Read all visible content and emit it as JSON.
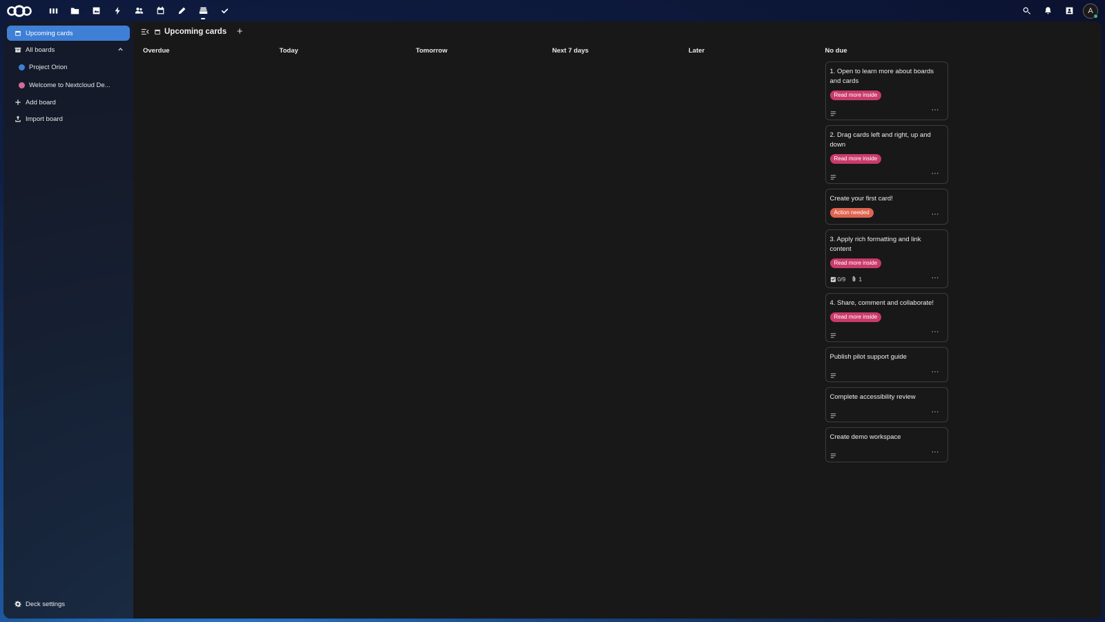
{
  "topbar": {
    "apps": [
      {
        "icon": "dashboard-icon"
      },
      {
        "icon": "files-icon"
      },
      {
        "icon": "photos-icon"
      },
      {
        "icon": "activity-icon"
      },
      {
        "icon": "contacts-icon"
      },
      {
        "icon": "calendar-icon"
      },
      {
        "icon": "notes-icon"
      },
      {
        "icon": "deck-icon",
        "active": true
      },
      {
        "icon": "tasks-icon"
      }
    ],
    "avatar_initial": "A"
  },
  "sidebar": {
    "items": [
      {
        "label": "Upcoming cards"
      },
      {
        "label": "All boards"
      },
      {
        "label": "Project Orion",
        "color": "#3f7fd6"
      },
      {
        "label": "Welcome to Nextcloud De...",
        "color": "#d36a9b"
      },
      {
        "label": "Add board"
      },
      {
        "label": "Import board"
      }
    ],
    "settings_label": "Deck settings"
  },
  "main": {
    "title": "Upcoming cards"
  },
  "columns": [
    {
      "title": "Overdue"
    },
    {
      "title": "Today"
    },
    {
      "title": "Tomorrow"
    },
    {
      "title": "Next 7 days"
    },
    {
      "title": "Later"
    },
    {
      "title": "No due"
    }
  ],
  "cards": [
    {
      "title": "1. Open to learn more about boards and cards",
      "label": "Read more inside",
      "label_color": "#c93b6a"
    },
    {
      "title": "2. Drag cards left and right, up and down",
      "label": "Read more inside",
      "label_color": "#c93b6a"
    },
    {
      "title": "Create your first card!",
      "label": "Action needed",
      "label_color": "#e0644f"
    },
    {
      "title": "3. Apply rich formatting and link content",
      "label": "Read more inside",
      "label_color": "#c93b6a",
      "checklist": "0/9",
      "attachments": "1"
    },
    {
      "title": "4. Share, comment and collaborate!",
      "label": "Read more inside",
      "label_color": "#c93b6a"
    },
    {
      "title": "Publish pilot support guide"
    },
    {
      "title": "Complete accessibility review"
    },
    {
      "title": "Create demo workspace"
    }
  ],
  "colors": {
    "accent": "#3f7fd6",
    "panel": "#181818",
    "read_more_label": "#c93b6a",
    "action_label": "#e0644f"
  }
}
